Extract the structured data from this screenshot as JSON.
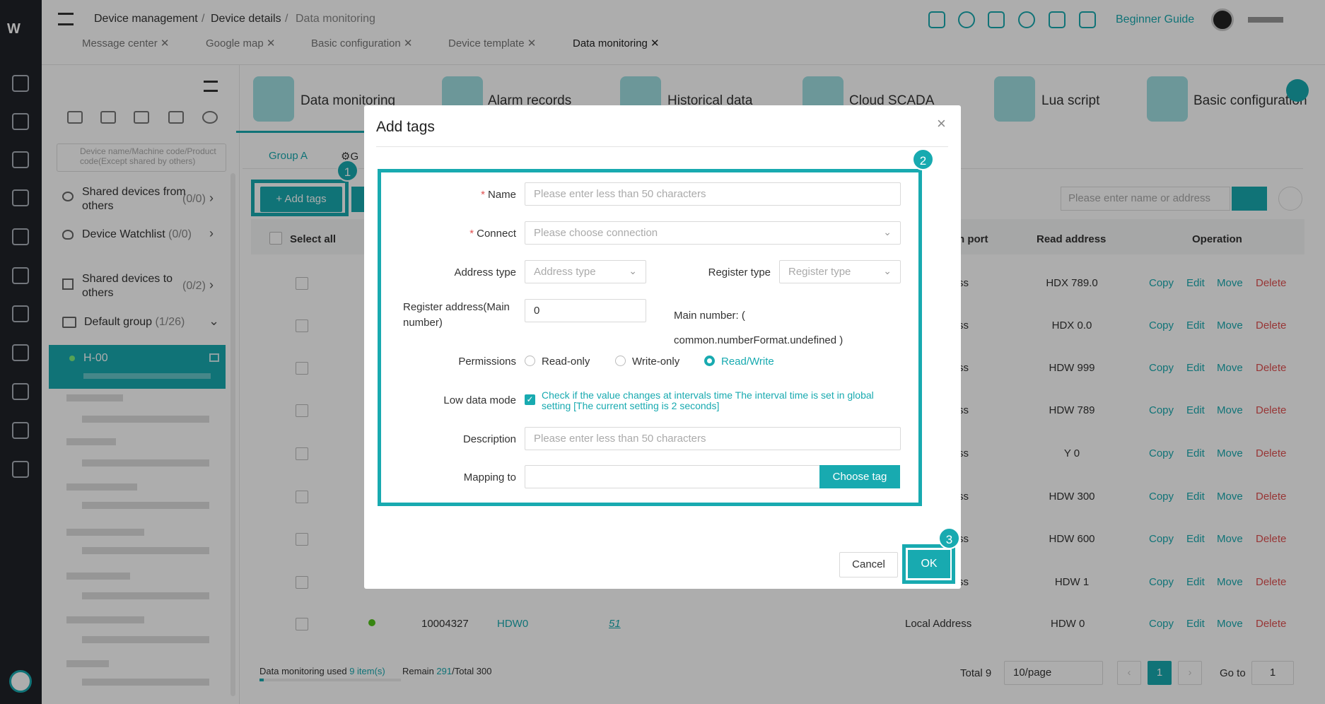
{
  "breadcrumb": [
    "Device management",
    "Device details",
    "Data monitoring"
  ],
  "tabs": [
    {
      "label": "Message center"
    },
    {
      "label": "Google map"
    },
    {
      "label": "Basic configuration"
    },
    {
      "label": "Device template"
    },
    {
      "label": "Data monitoring"
    }
  ],
  "header": {
    "guide": "Beginner Guide"
  },
  "sidebar": {
    "search_placeholder": "Device name/Machine code/Product code(Except shared by others)",
    "shared_from": "Shared devices from others",
    "shared_from_count": "(0/0)",
    "watchlist": "Device Watchlist",
    "watchlist_count": "(0/0)",
    "shared_to": "Shared devices to others",
    "shared_to_count": "(0/2)",
    "default_group": "Default group",
    "default_group_count": "(1/26)",
    "selected_device": "H-00"
  },
  "modules": [
    "Data monitoring",
    "Alarm records",
    "Historical data",
    "Cloud SCADA",
    "Lua script",
    "Basic configuration"
  ],
  "group_tab": "Group A",
  "toolbar": {
    "add_tags": "+ Add tags",
    "search_placeholder": "Please enter name or address"
  },
  "table": {
    "headers": {
      "select_all": "Select all",
      "port": "n port",
      "read_address": "Read address",
      "operation": "Operation"
    },
    "rows": [
      {
        "port": "ss",
        "read": "HDX 789.0"
      },
      {
        "port": "ss",
        "read": "HDX 0.0"
      },
      {
        "port": "ss",
        "read": "HDW 999"
      },
      {
        "port": "ss",
        "read": "HDW 789"
      },
      {
        "port": "ss",
        "read": "Y 0"
      },
      {
        "port": "ss",
        "read": "HDW 300"
      },
      {
        "port": "ss",
        "read": "HDW 600"
      },
      {
        "port": "ss",
        "read": "HDW 1"
      }
    ],
    "last_row": {
      "id": "10004327",
      "name": "HDW0",
      "value": "51",
      "port": "Local Address",
      "read": "HDW 0"
    },
    "ops": [
      "Copy",
      "Edit",
      "Move",
      "Delete"
    ]
  },
  "footer": {
    "used_label": "Data monitoring used",
    "used_value": "9 item(s)",
    "remain_label": "Remain",
    "remain_value": "291",
    "total_label": "/Total 300",
    "total": "Total 9",
    "page_size": "10/page",
    "page": "1",
    "goto": "Go to",
    "goto_value": "1"
  },
  "modal": {
    "title": "Add tags",
    "name_label": "Name",
    "name_placeholder": "Please enter less than 50 characters",
    "connect_label": "Connect",
    "connect_placeholder": "Please choose connection",
    "address_type_label": "Address type",
    "address_type_placeholder": "Address type",
    "register_type_label": "Register type",
    "register_type_placeholder": "Register type",
    "register_address_label": "Register address(Main number)",
    "register_address_value": "0",
    "main_number_hint": "Main number: ( common.numberFormat.undefined )",
    "permissions_label": "Permissions",
    "perm_read": "Read-only",
    "perm_write": "Write-only",
    "perm_rw": "Read/Write",
    "low_data_label": "Low data mode",
    "low_data_text": "Check if the value changes at intervals time The interval time is set in global setting [The current setting is 2 seconds]",
    "description_label": "Description",
    "description_placeholder": "Please enter less than 50 characters",
    "mapping_label": "Mapping to",
    "choose_tag": "Choose tag",
    "cancel": "Cancel",
    "ok": "OK"
  },
  "badges": [
    "1",
    "2",
    "3"
  ],
  "colors": {
    "accent": "#18aab0",
    "danger": "#e05050"
  }
}
